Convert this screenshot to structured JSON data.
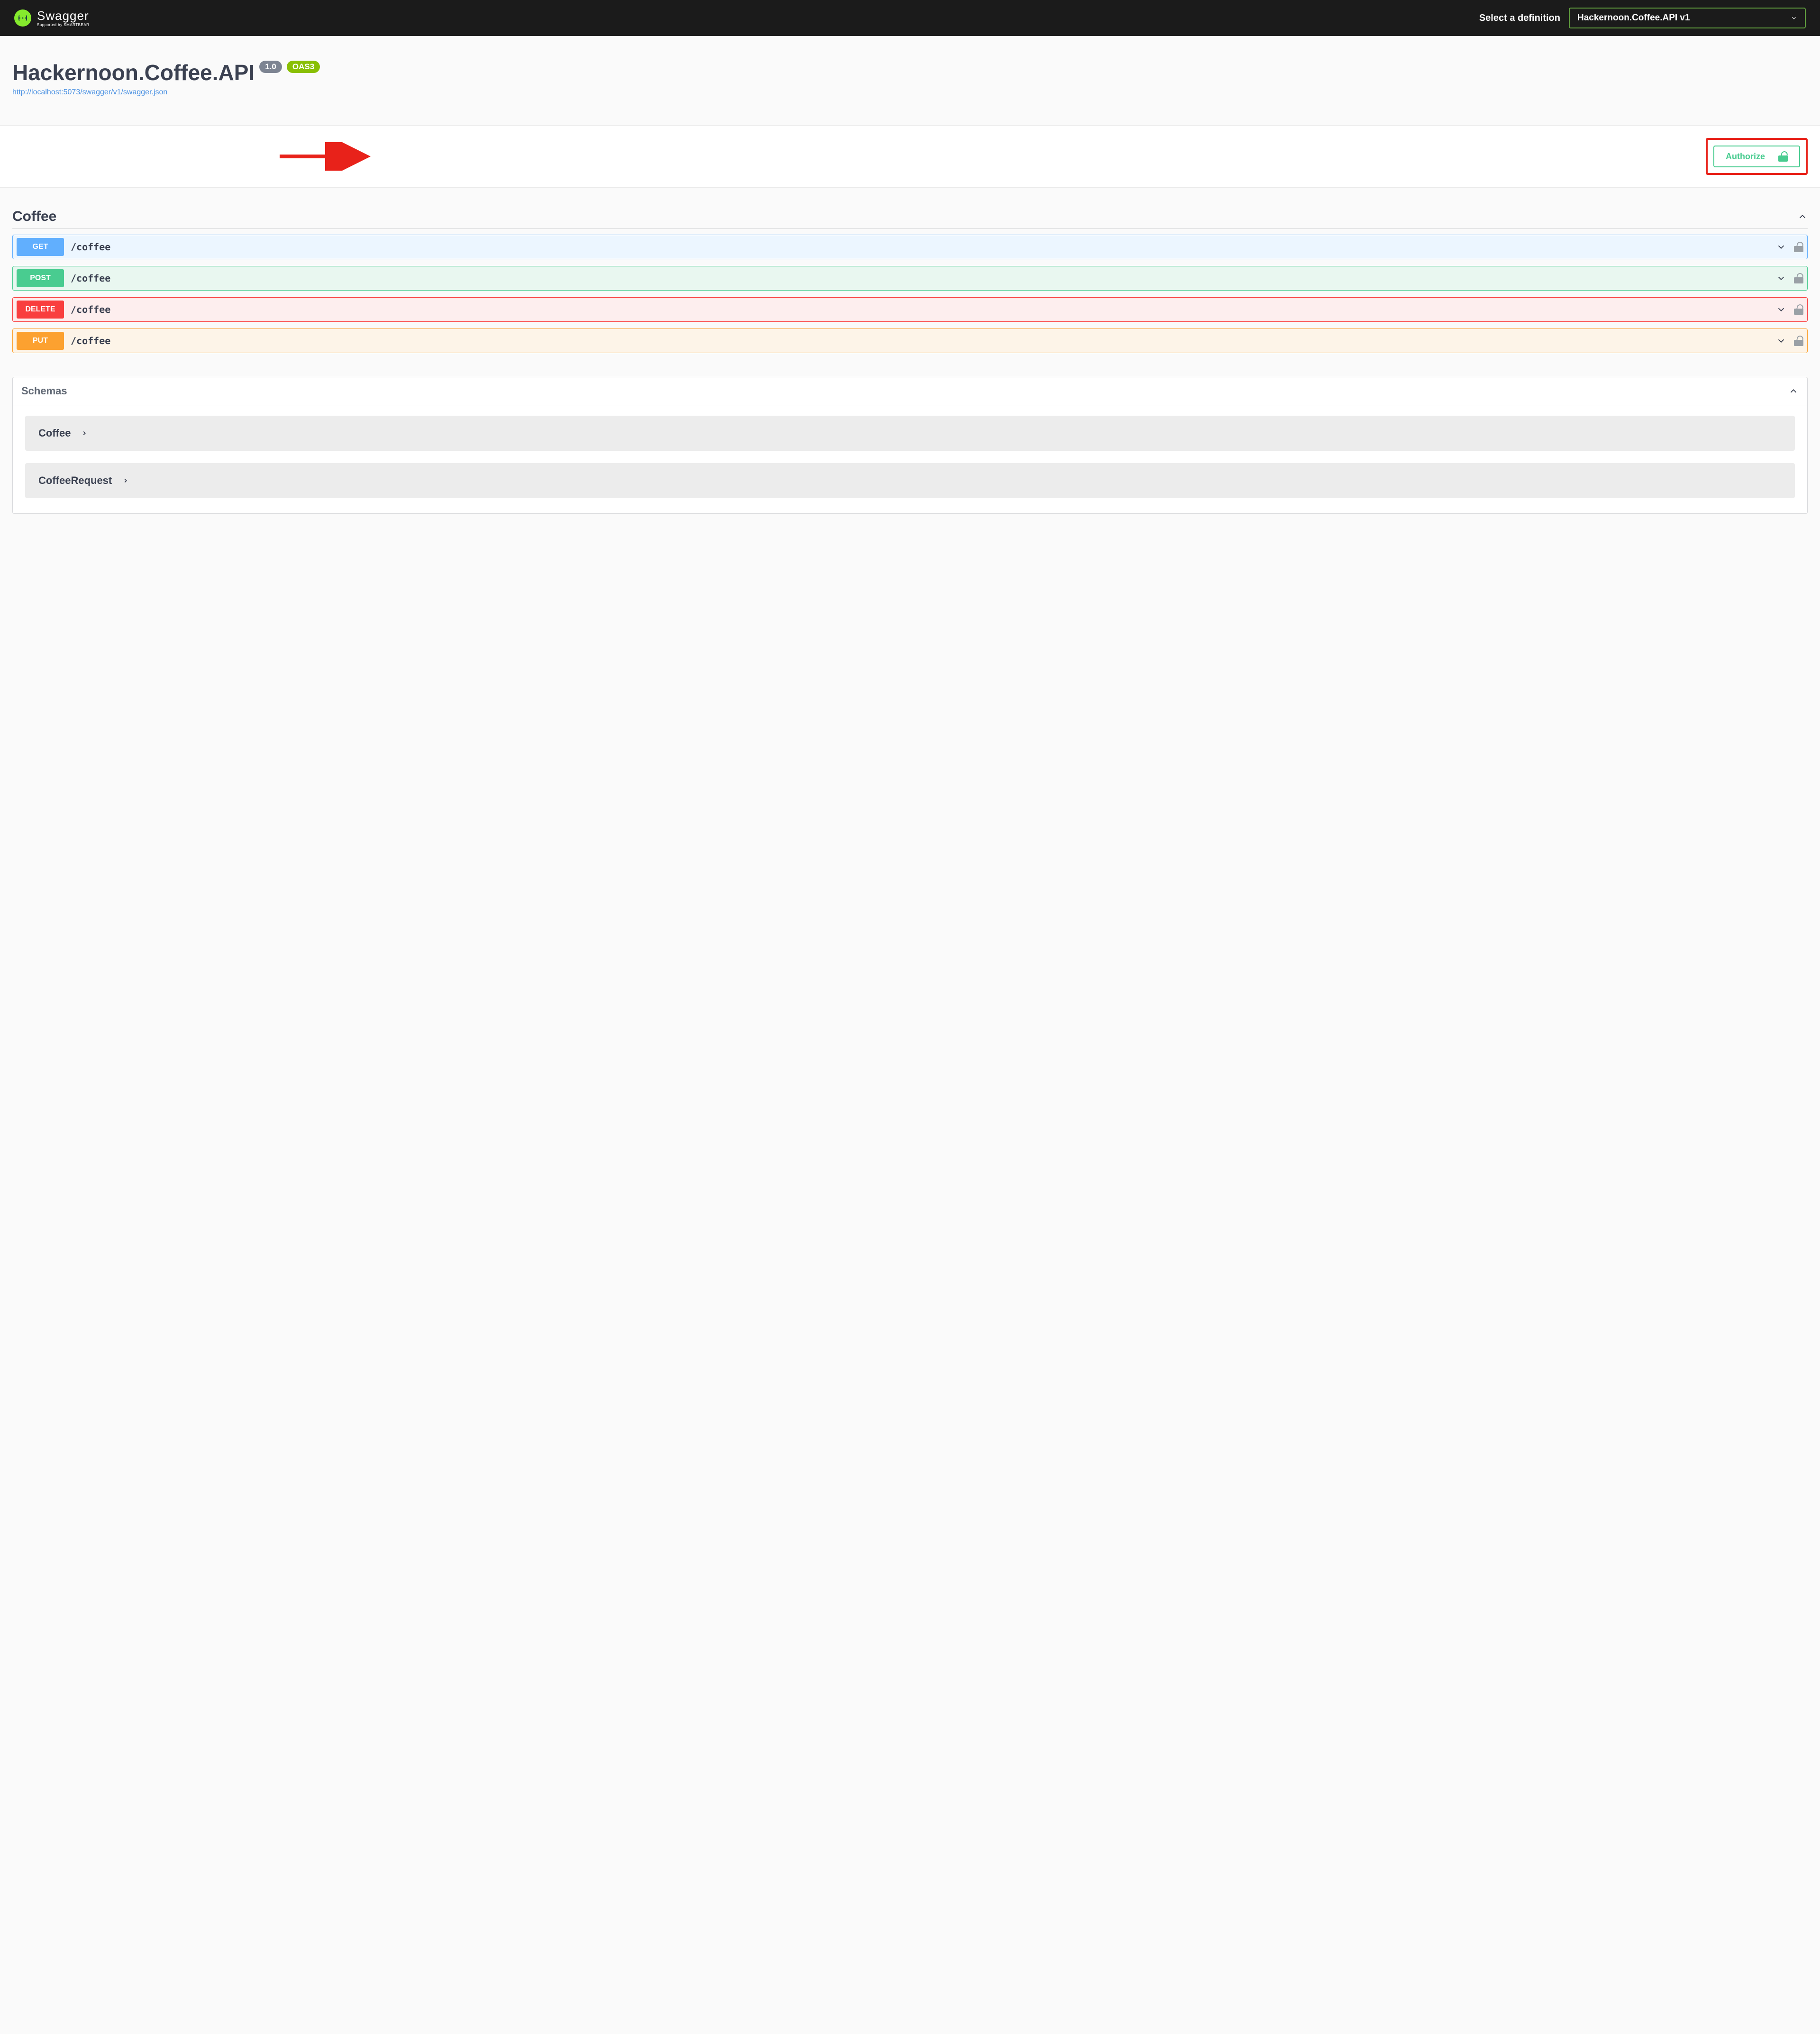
{
  "topbar": {
    "brand": "Swagger",
    "brand_sub": "Supported by SMARTBEAR",
    "definition_label": "Select a definition",
    "definition_selected": "Hackernoon.Coffee.API v1"
  },
  "info": {
    "title": "Hackernoon.Coffee.API",
    "version": "1.0",
    "oas": "OAS3",
    "swagger_url": "http://localhost:5073/swagger/v1/swagger.json"
  },
  "auth": {
    "authorize_label": "Authorize"
  },
  "tags": [
    {
      "name": "Coffee"
    }
  ],
  "operations": [
    {
      "method": "GET",
      "path": "/coffee",
      "method_class": "get"
    },
    {
      "method": "POST",
      "path": "/coffee",
      "method_class": "post"
    },
    {
      "method": "DELETE",
      "path": "/coffee",
      "method_class": "delete"
    },
    {
      "method": "PUT",
      "path": "/coffee",
      "method_class": "put"
    }
  ],
  "schemas": {
    "title": "Schemas",
    "items": [
      {
        "name": "Coffee"
      },
      {
        "name": "CoffeeRequest"
      }
    ]
  }
}
